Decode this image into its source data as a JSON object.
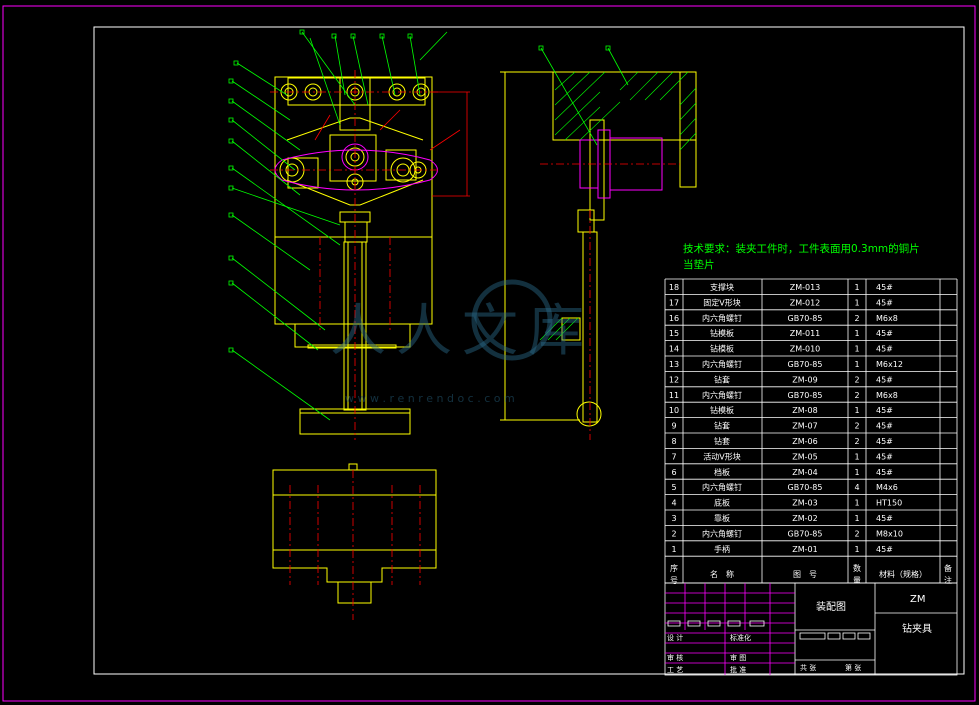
{
  "note": {
    "line1": "技术要求：装夹工件时，工件表面用0.3mm的铜片",
    "line2": "当垫片"
  },
  "watermark": {
    "text": "人人文库",
    "url": "w w w . r e n r e n d o c . c o m"
  },
  "bom": {
    "rows": [
      {
        "no": "18",
        "name": "支撑块",
        "code": "ZM-013",
        "qty": "1",
        "mat": "45#"
      },
      {
        "no": "17",
        "name": "固定V形块",
        "code": "ZM-012",
        "qty": "1",
        "mat": "45#"
      },
      {
        "no": "16",
        "name": "内六角螺钉",
        "code": "GB70-85",
        "qty": "2",
        "mat": "M6x8"
      },
      {
        "no": "15",
        "name": "钻模板",
        "code": "ZM-011",
        "qty": "1",
        "mat": "45#"
      },
      {
        "no": "14",
        "name": "钻模板",
        "code": "ZM-010",
        "qty": "1",
        "mat": "45#"
      },
      {
        "no": "13",
        "name": "内六角螺钉",
        "code": "GB70-85",
        "qty": "1",
        "mat": "M6x12"
      },
      {
        "no": "12",
        "name": "钻套",
        "code": "ZM-09",
        "qty": "2",
        "mat": "45#"
      },
      {
        "no": "11",
        "name": "内六角螺钉",
        "code": "GB70-85",
        "qty": "2",
        "mat": "M6x8"
      },
      {
        "no": "10",
        "name": "钻模板",
        "code": "ZM-08",
        "qty": "1",
        "mat": "45#"
      },
      {
        "no": "9",
        "name": "钻套",
        "code": "ZM-07",
        "qty": "2",
        "mat": "45#"
      },
      {
        "no": "8",
        "name": "钻套",
        "code": "ZM-06",
        "qty": "2",
        "mat": "45#"
      },
      {
        "no": "7",
        "name": "活动V形块",
        "code": "ZM-05",
        "qty": "1",
        "mat": "45#"
      },
      {
        "no": "6",
        "name": "档板",
        "code": "ZM-04",
        "qty": "1",
        "mat": "45#"
      },
      {
        "no": "5",
        "name": "内六角螺钉",
        "code": "GB70-85",
        "qty": "4",
        "mat": "M4x6"
      },
      {
        "no": "4",
        "name": "底板",
        "code": "ZM-03",
        "qty": "1",
        "mat": "HT150"
      },
      {
        "no": "3",
        "name": "靠板",
        "code": "ZM-02",
        "qty": "1",
        "mat": "45#"
      },
      {
        "no": "2",
        "name": "内六角螺钉",
        "code": "GB70-85",
        "qty": "2",
        "mat": "M8x10"
      },
      {
        "no": "1",
        "name": "手柄",
        "code": "ZM-01",
        "qty": "1",
        "mat": "45#"
      }
    ],
    "header": {
      "no_top": "序",
      "no_bot": "号",
      "name": "名　称",
      "code": "图　号",
      "qty_top": "数",
      "qty_bot": "量",
      "mat": "材料（规格）",
      "remark_top": "备",
      "remark_bot": "注"
    }
  },
  "titleblock": {
    "assembly": "装配图",
    "code": "ZM",
    "name": "钻夹具",
    "design": "设 计",
    "standard": "标准化",
    "check": "审 核",
    "process": "工 艺",
    "review": "审 图",
    "approve": "批 准",
    "sheet_total": "共 张",
    "sheet_no": "第 张"
  },
  "colors": {
    "frame": "#ff00ff",
    "outline": "#ffff00",
    "center": "#ff0000",
    "leader": "#00ff00",
    "hatch": "#00ff00",
    "text": "#ffffff",
    "part": "#ff00ff"
  }
}
